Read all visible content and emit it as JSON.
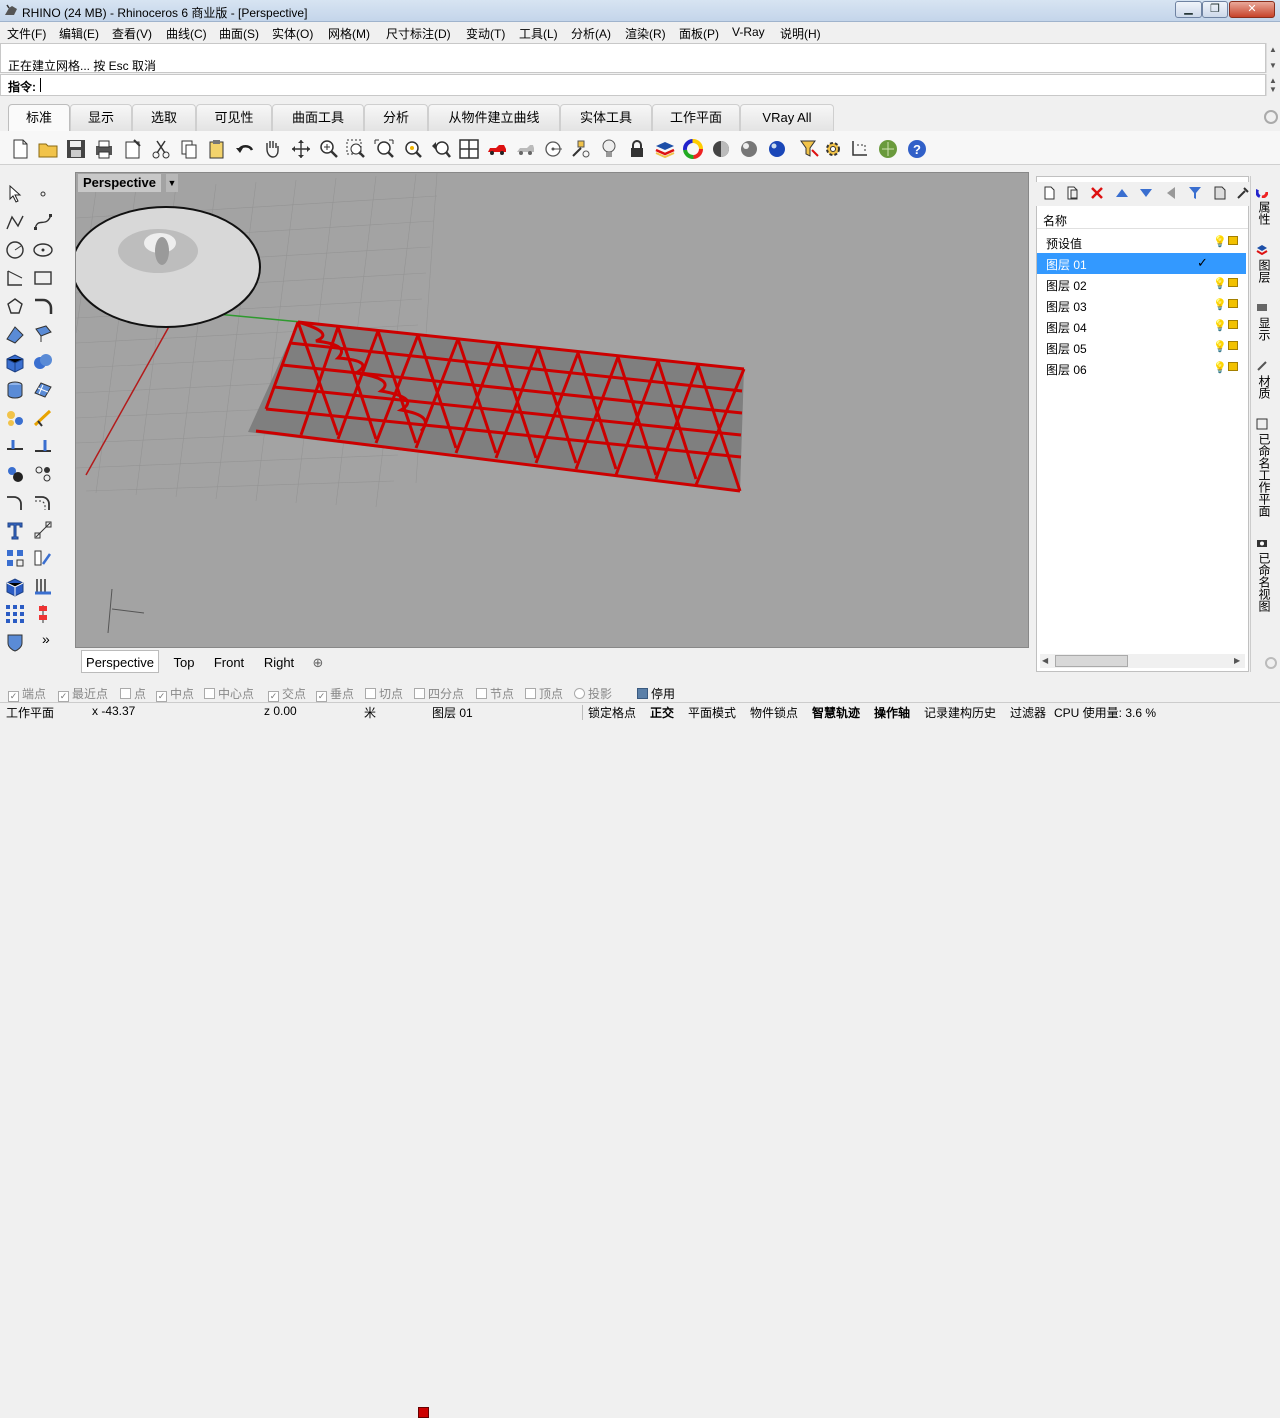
{
  "window": {
    "title": "RHINO (24 MB) - Rhinoceros 6 商业版 - [Perspective]"
  },
  "menu": [
    "文件(F)",
    "编辑(E)",
    "查看(V)",
    "曲线(C)",
    "曲面(S)",
    "实体(O)",
    "网格(M)",
    "尺寸标注(D)",
    "变动(T)",
    "工具(L)",
    "分析(A)",
    "渲染(R)",
    "面板(P)",
    "V-Ray",
    "说明(H)"
  ],
  "command": {
    "history_line": "正在建立网格... 按 Esc 取消",
    "prompt_label": "指令:"
  },
  "tabs": [
    "标准",
    "显示",
    "选取",
    "可见性",
    "曲面工具",
    "分析",
    "从物件建立曲线",
    "实体工具",
    "工作平面",
    "VRay All"
  ],
  "active_tab": "标准",
  "viewport": {
    "name": "Perspective",
    "tabs": [
      "Perspective",
      "Top",
      "Front",
      "Right"
    ],
    "active_tab": "Perspective",
    "add_tab_symbol": "⊕"
  },
  "layers_panel": {
    "column_header": "名称",
    "rows": [
      {
        "name": "预设值",
        "color": "#000000",
        "selected": false,
        "current": false
      },
      {
        "name": "图层 01",
        "color": "#cc0000",
        "selected": true,
        "current": true
      },
      {
        "name": "图层 02",
        "color": "#000000",
        "selected": false,
        "current": false
      },
      {
        "name": "图层 03",
        "color": "#000000",
        "selected": false,
        "current": false
      },
      {
        "name": "图层 04",
        "color": "#000000",
        "selected": false,
        "current": false
      },
      {
        "name": "图层 05",
        "color": "#000000",
        "selected": false,
        "current": false
      },
      {
        "name": "图层 06",
        "color": "#000000",
        "selected": false,
        "current": false
      }
    ],
    "current_check": "✓"
  },
  "right_side_tabs": [
    "属性",
    "图层",
    "显示",
    "材质",
    "已命名工作平面",
    "已命名视图"
  ],
  "osnaps": [
    {
      "label": "端点",
      "checked": true
    },
    {
      "label": "最近点",
      "checked": true
    },
    {
      "label": "点",
      "checked": false
    },
    {
      "label": "中点",
      "checked": true
    },
    {
      "label": "中心点",
      "checked": false
    },
    {
      "label": "交点",
      "checked": true
    },
    {
      "label": "垂点",
      "checked": true
    },
    {
      "label": "切点",
      "checked": false
    },
    {
      "label": "四分点",
      "checked": false
    },
    {
      "label": "节点",
      "checked": false
    },
    {
      "label": "顶点",
      "checked": false
    },
    {
      "label": "投影",
      "checked": false
    }
  ],
  "osnap_disable": "停用",
  "status": {
    "cplane": "工作平面",
    "x": "x -43.37",
    "z": "z 0.00",
    "unit": "米",
    "layer": "图层 01",
    "layer_color": "#cc0000",
    "grid_snap": "锁定格点",
    "ortho": "正交",
    "planar": "平面模式",
    "osnap": "物件锁点",
    "smarttrack": "智慧轨迹",
    "gumball": "操作轴",
    "history": "记录建构历史",
    "filter": "过滤器",
    "cpu": "CPU 使用量: 3.6 %"
  },
  "colors": {
    "accent": "#3399ff",
    "mesh_red": "#cc0000",
    "viewport_bg": "#a3a3a3"
  }
}
